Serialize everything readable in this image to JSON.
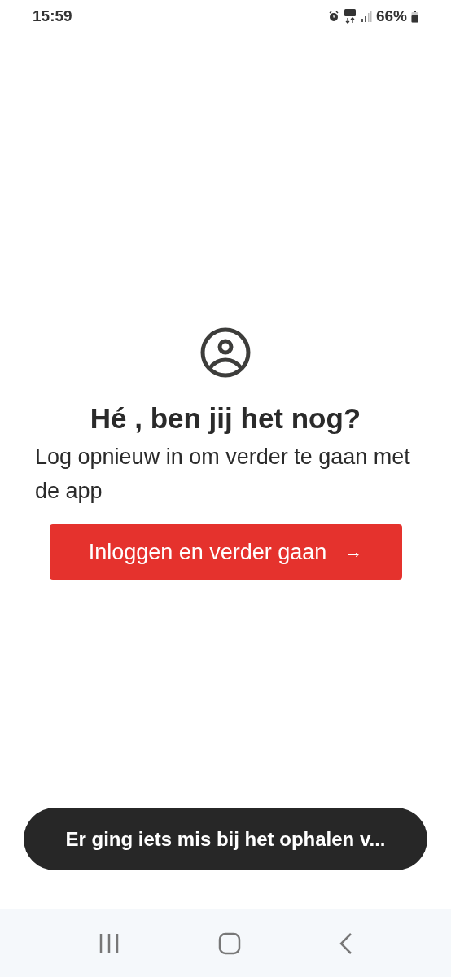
{
  "status_bar": {
    "time": "15:59",
    "battery": "66%"
  },
  "prompt": {
    "title": "Hé , ben jij het nog?",
    "message": "Log opnieuw in om verder te gaan met de app"
  },
  "button": {
    "label": "Inloggen en verder gaan",
    "arrow": "→"
  },
  "toast": {
    "message": "Er ging iets mis bij het ophalen v..."
  }
}
